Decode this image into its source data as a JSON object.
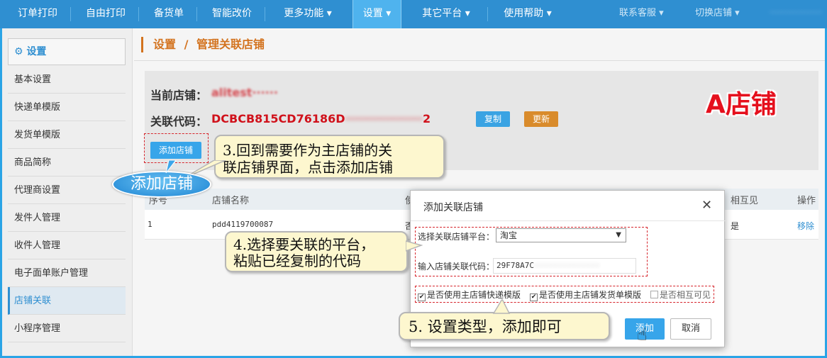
{
  "nav": {
    "items": [
      {
        "label": "订单打印"
      },
      {
        "label": "自由打印"
      },
      {
        "label": "备货单"
      },
      {
        "label": "智能改价"
      },
      {
        "label": "更多功能 ▾"
      },
      {
        "label": "设置 ▾"
      },
      {
        "label": "其它平台 ▾"
      },
      {
        "label": "使用帮助 ▾"
      }
    ],
    "contact": "联系客服 ▾",
    "switch_store": "切换店铺 ▾",
    "account": "··················"
  },
  "sidebar": {
    "title": "设置",
    "items": [
      {
        "label": "基本设置"
      },
      {
        "label": "快递单模版"
      },
      {
        "label": "发货单模版"
      },
      {
        "label": "商品简称"
      },
      {
        "label": "代理商设置"
      },
      {
        "label": "发件人管理"
      },
      {
        "label": "收件人管理"
      },
      {
        "label": "电子面单账户管理"
      },
      {
        "label": "店铺关联"
      },
      {
        "label": "小程序管理"
      }
    ]
  },
  "breadcrumb": {
    "root": "设置",
    "sep": "/",
    "current": "管理关联店铺"
  },
  "store": {
    "current_label": "当前店铺：",
    "current_value": "alitest······",
    "code_label": "关联代码：",
    "code_value": "DCBCB815CD76186D",
    "code_hidden": "··················",
    "code_tail": "2",
    "copy_btn": "复制",
    "refresh_btn": "更新",
    "add_btn": "添加店铺"
  },
  "watermark": "A店铺",
  "bubble": "添加店铺",
  "callouts": {
    "c3_line1": "3.回到需要作为主店铺的关",
    "c3_line2": "联店铺界面，点击添加店铺",
    "c4_line1": "4.选择要关联的平台，",
    "c4_line2": "粘贴已经复制的代码",
    "c5": "5. 设置类型，添加即可"
  },
  "table": {
    "headers": [
      "序号",
      "店铺名称",
      "使",
      "相互见",
      "操作"
    ],
    "rows": [
      {
        "index": "1",
        "name": "pdd4119700087",
        "used": "否",
        "mutual": "是",
        "action": "移除"
      }
    ]
  },
  "modal": {
    "title": "添加关联店铺",
    "close": "✕",
    "platform_label": "选择关联店铺平台：",
    "platform_value": "淘宝",
    "code_label": "输入店铺关联代码：",
    "code_value": "29F78A7C",
    "code_hidden": "··············",
    "opt1": "是否使用主店铺快递模版",
    "opt2": "是否使用主店铺发货单模版",
    "opt3": "是否相互可见",
    "add_btn": "添加",
    "cancel_btn": "取消"
  },
  "colors": {
    "nav": "#2f8fd1",
    "accent": "#37a5ea",
    "alert": "#d0111b",
    "orange": "#d3731f"
  }
}
